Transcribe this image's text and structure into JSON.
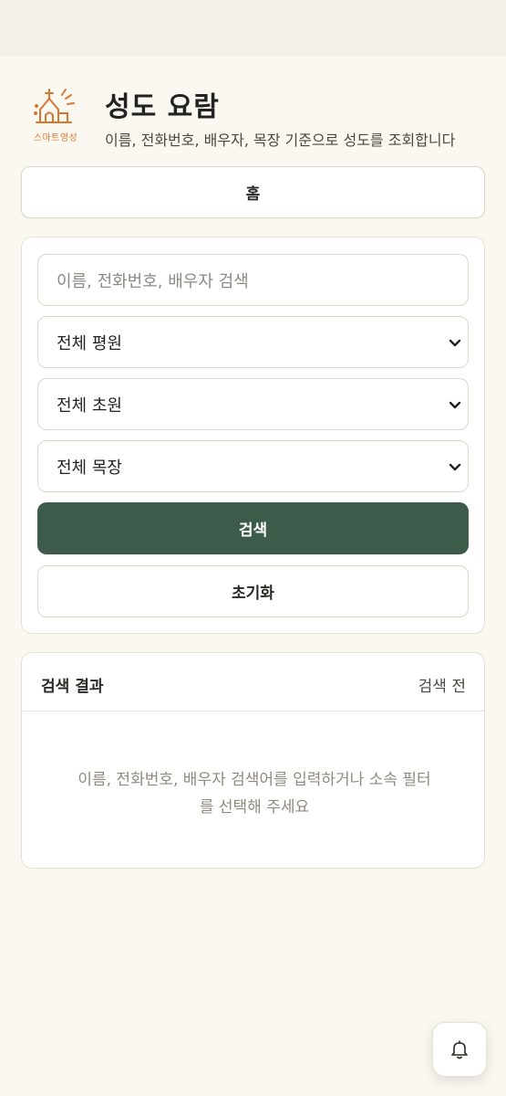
{
  "header": {
    "logo_text": "스마트영성",
    "title": "성도 요람",
    "subtitle": "이름, 전화번호, 배우자, 목장 기준으로 성도를 조회합니다"
  },
  "nav": {
    "home_label": "홈"
  },
  "search": {
    "placeholder": "이름, 전화번호, 배우자 검색",
    "filters": [
      {
        "selected": "전체 평원"
      },
      {
        "selected": "전체 초원"
      },
      {
        "selected": "전체 목장"
      }
    ],
    "search_label": "검색",
    "reset_label": "초기화"
  },
  "results": {
    "title": "검색 결과",
    "status": "검색 전",
    "empty_message": "이름, 전화번호, 배우자 검색어를 입력하거나 소속 필터를 선택해 주세요"
  },
  "icons": {
    "logo": "church-logo-icon",
    "select": "chevron-down-icon",
    "notifications": "bell-icon"
  },
  "colors": {
    "accent": "#3d5b4a",
    "logo": "#d9772f",
    "background": "#fbf8f1"
  }
}
